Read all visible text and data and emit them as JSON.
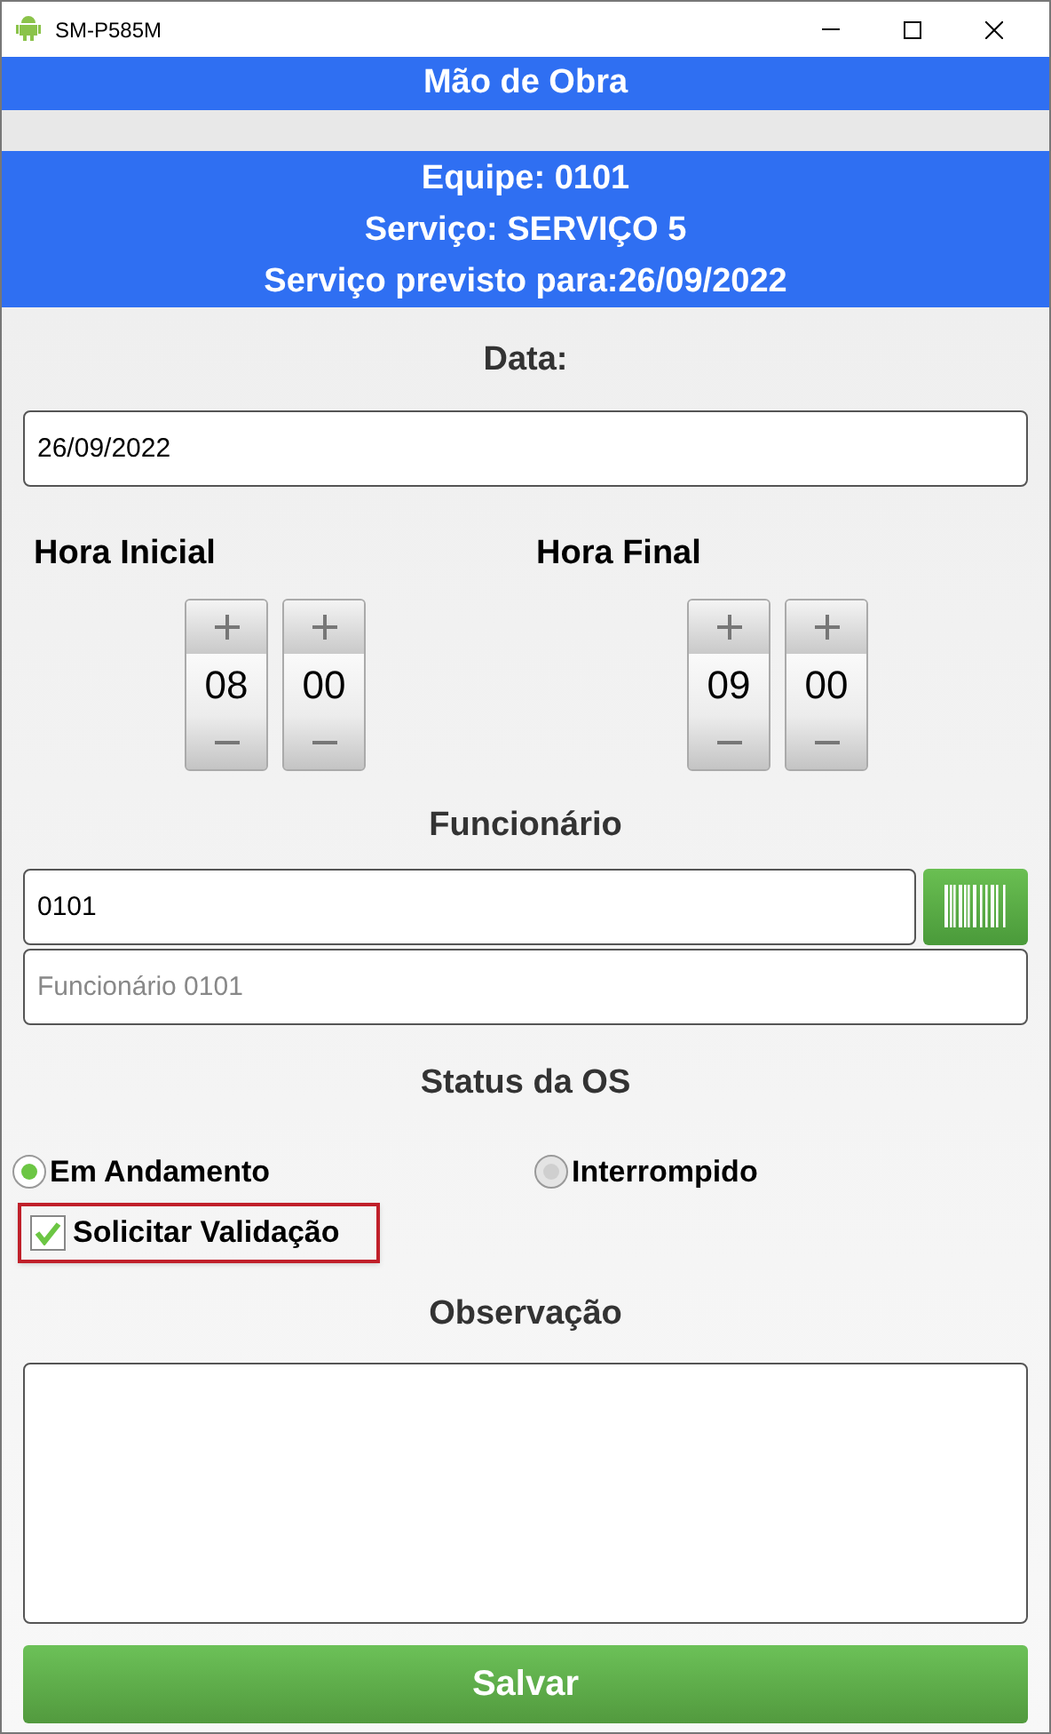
{
  "window": {
    "title": "SM-P585M"
  },
  "header": {
    "title": "Mão de Obra"
  },
  "info": [
    "Equipe: 0101",
    "Serviço: SERVIÇO 5",
    "Serviço previsto para:26/09/2022"
  ],
  "date": {
    "label": "Data:",
    "value": "26/09/2022"
  },
  "time_pickers": [
    {
      "label": "Hora Inicial",
      "hour": "08",
      "minute": "00"
    },
    {
      "label": "Hora Final",
      "hour": "09",
      "minute": "00"
    }
  ],
  "employee": {
    "label": "Funcionário",
    "code": "0101",
    "name_placeholder": "Funcionário 0101"
  },
  "status": {
    "label": "Status da OS",
    "options": [
      {
        "label": "Em Andamento",
        "selected": true
      },
      {
        "label": "Interrompido",
        "selected": false
      }
    ]
  },
  "request_validation": {
    "label": "Solicitar Validação",
    "checked": true
  },
  "observation": {
    "label": "Observação"
  },
  "save_button": "Salvar"
}
